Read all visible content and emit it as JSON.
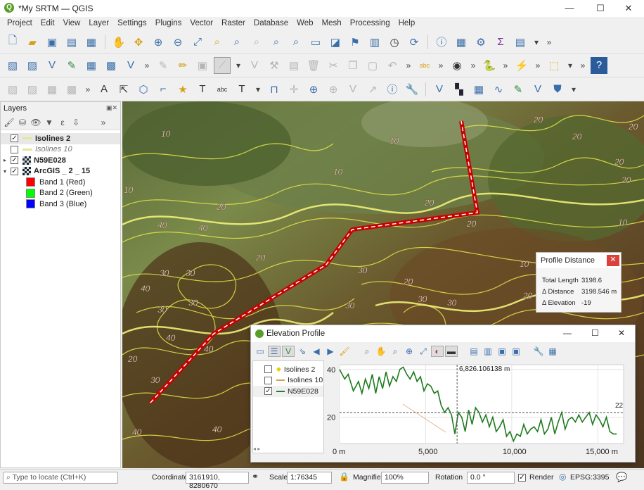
{
  "window": {
    "title": "*My SRTM — QGIS"
  },
  "menu": [
    "Project",
    "Edit",
    "View",
    "Layer",
    "Settings",
    "Plugins",
    "Vector",
    "Raster",
    "Database",
    "Web",
    "Mesh",
    "Processing",
    "Help"
  ],
  "layers_panel": {
    "title": "Layers",
    "items": [
      {
        "name": "Isolines 2",
        "checked": true,
        "bold": true
      },
      {
        "name": "Isolines 10",
        "checked": false,
        "italic": true
      },
      {
        "name": "N59E028",
        "checked": true,
        "bold": true
      },
      {
        "name": "ArcGIS _ 2 _ 15",
        "checked": true,
        "bold": true
      },
      {
        "name": "Band 1 (Red)",
        "color": "#ff0000"
      },
      {
        "name": "Band 2 (Green)",
        "color": "#00ff00"
      },
      {
        "name": "Band 3 (Blue)",
        "color": "#0000ff"
      }
    ]
  },
  "map": {
    "contour_labels": [
      "10",
      "10",
      "10",
      "10",
      "20",
      "20",
      "20",
      "20",
      "20",
      "20",
      "20",
      "20",
      "30",
      "30",
      "30",
      "30",
      "30",
      "30",
      "30",
      "30",
      "40",
      "40",
      "40",
      "40",
      "40",
      "40",
      "40",
      "10",
      "10",
      "20",
      "20",
      "20",
      "20",
      "30",
      "20",
      "20"
    ]
  },
  "profile_distance": {
    "title": "Profile Distance",
    "rows": [
      {
        "label": "Total Length",
        "value": "3198.6"
      },
      {
        "label": "Δ Distance",
        "value": "3198.546 m"
      },
      {
        "label": "Δ Elevation",
        "value": "-19"
      }
    ]
  },
  "elevation_profile": {
    "title": "Elevation Profile",
    "legend": [
      {
        "name": "Isolines 2",
        "checked": false
      },
      {
        "name": "Isolines 10",
        "checked": false
      },
      {
        "name": "N59E028",
        "checked": true
      }
    ],
    "cursor_label": "6,826.106138 m",
    "cursor_value_label": "22",
    "y_ticks": [
      "40",
      "20"
    ],
    "x_ticks": [
      "0 m",
      "5,000",
      "10,000",
      "15,000 m"
    ]
  },
  "status": {
    "locate_placeholder": "Type to locate (Ctrl+K)",
    "coordinate_label": "Coordinate",
    "coordinate": "3161910, 8280670",
    "scale_label": "Scale",
    "scale": "1:76345",
    "magnifier_label": "Magnifier",
    "magnifier": "100%",
    "rotation_label": "Rotation",
    "rotation": "0.0 °",
    "render_label": "Render",
    "crs": "EPSG:3395"
  },
  "chart_data": {
    "type": "line",
    "title": "",
    "xlabel": "",
    "ylabel": "",
    "xlim": [
      0,
      16500
    ],
    "ylim": [
      9,
      42
    ],
    "series": [
      {
        "name": "N59E028",
        "x": [
          0,
          300,
          500,
          800,
          1100,
          1300,
          1500,
          1700,
          1900,
          2100,
          2300,
          2500,
          2700,
          2900,
          3100,
          3300,
          3500,
          3700,
          3900,
          4100,
          4300,
          4500,
          4700,
          4900,
          5100,
          5300,
          5500,
          5700,
          5900,
          6100,
          6300,
          6500,
          6700,
          6900,
          7100,
          7300,
          7500,
          7700,
          7900,
          8100,
          8300,
          8500,
          8700,
          8900,
          9100,
          9300,
          9500,
          9700,
          9900,
          10100,
          10300,
          10500,
          10700,
          10900,
          11100,
          11300,
          11500,
          11700,
          11900,
          12100,
          12300,
          12500,
          12700,
          12900,
          13100,
          13300,
          13500,
          13700,
          13900,
          14100,
          14300,
          14500,
          14700,
          14900,
          15100,
          15300,
          15500,
          15700,
          15900,
          16100
        ],
        "y": [
          40,
          36,
          38,
          31,
          35,
          30,
          36,
          32,
          38,
          30,
          37,
          32,
          39,
          33,
          37,
          35,
          40,
          41,
          38,
          36,
          39,
          35,
          37,
          31,
          34,
          33,
          30,
          31,
          25,
          22,
          24,
          21,
          13,
          22,
          20,
          14,
          23,
          17,
          24,
          22,
          18,
          21,
          16,
          20,
          14,
          16,
          19,
          12,
          14,
          10,
          13,
          12,
          17,
          13,
          15,
          16,
          14,
          19,
          13,
          15,
          20,
          13,
          18,
          22,
          15,
          19,
          20,
          18,
          21,
          18,
          20,
          22,
          17,
          21,
          19,
          16,
          20,
          14,
          13,
          13
        ]
      }
    ]
  }
}
